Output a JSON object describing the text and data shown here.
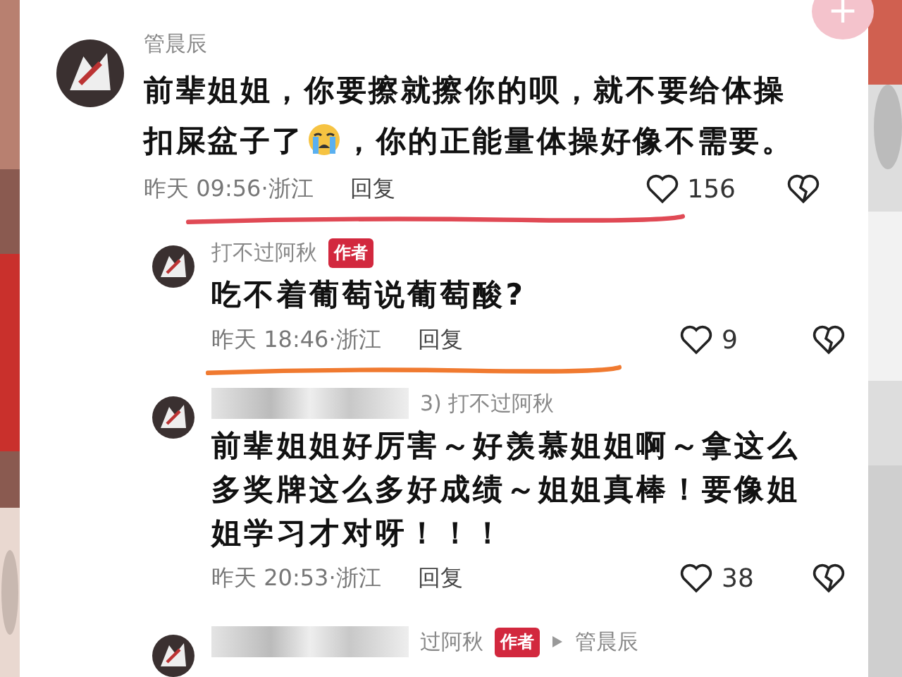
{
  "add_button": {
    "label": "+"
  },
  "comments": [
    {
      "kind": "top",
      "author": "管晨辰",
      "parts": [
        "前辈姐姐，你要擦就擦你的呗，就不要给体操扣屎盆子了",
        "，你的正能量体操好像不需要。"
      ],
      "time": "昨天 09:56·浙江",
      "reply": "回复",
      "likes": "156",
      "underline": {
        "color": "#e04a55"
      }
    },
    {
      "kind": "reply",
      "author": "打不过阿秋",
      "author_tag": "作者",
      "parts": [
        "吃不着葡萄说葡萄酸?"
      ],
      "time": "昨天 18:46·浙江",
      "reply": "回复",
      "likes": "9",
      "underline": {
        "color": "#f07a30"
      }
    },
    {
      "kind": "reply",
      "author": "3) 打不过阿秋",
      "redacted": true,
      "parts": [
        "前辈姐姐好厉害～好羡慕姐姐啊～拿这么多奖牌这么多好成绩～姐姐真棒！要像姐姐学习才对呀！！！"
      ],
      "time": "昨天 20:53·浙江",
      "reply": "回复",
      "likes": "38"
    },
    {
      "kind": "reply",
      "author": "过阿秋",
      "author_tag": "作者",
      "reply_to": "管晨辰",
      "redacted": true
    }
  ]
}
